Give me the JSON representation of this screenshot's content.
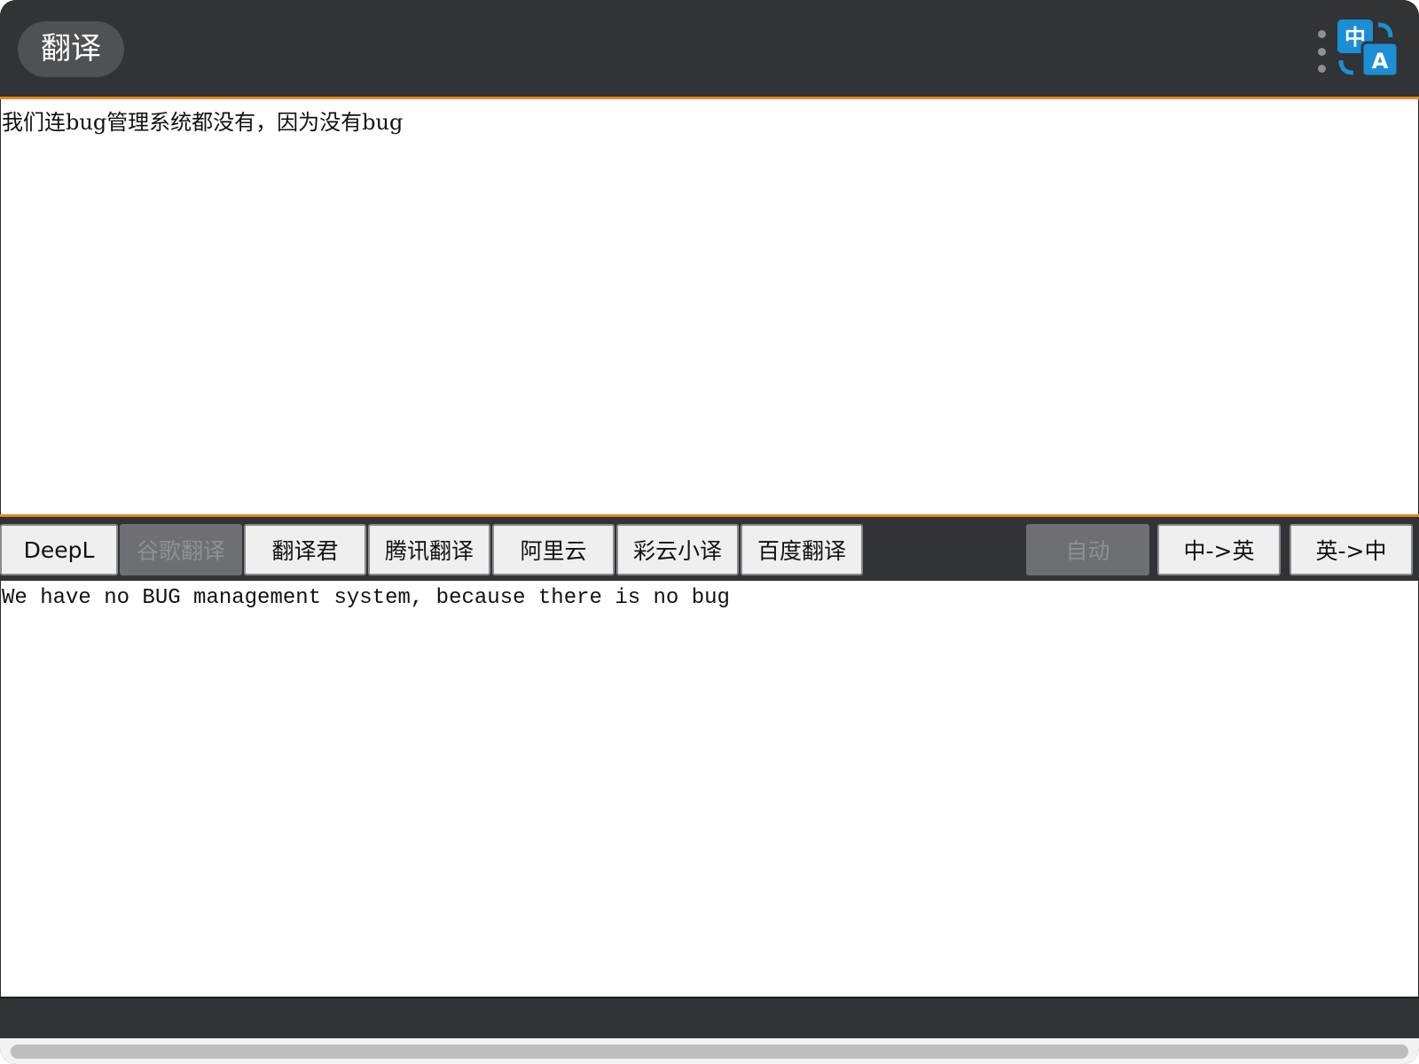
{
  "titlebar": {
    "title": "翻译",
    "menu_icon": "kebab-menu-icon",
    "logo_icon": "translate-zh-a-icon",
    "logo_glyph_zh": "中",
    "logo_glyph_en": "A"
  },
  "source": {
    "text": "我们连bug管理系统都没有，因为没有bug"
  },
  "engines": [
    {
      "label": "DeepL",
      "disabled": false
    },
    {
      "label": "谷歌翻译",
      "disabled": true
    },
    {
      "label": "翻译君",
      "disabled": false
    },
    {
      "label": "腾讯翻译",
      "disabled": false
    },
    {
      "label": "阿里云",
      "disabled": false
    },
    {
      "label": "彩云小译",
      "disabled": false
    },
    {
      "label": "百度翻译",
      "disabled": false
    }
  ],
  "directions": [
    {
      "label": "自动",
      "disabled": true
    },
    {
      "label": "中->英",
      "disabled": false
    },
    {
      "label": "英->中",
      "disabled": false
    }
  ],
  "result": {
    "text": "We have no BUG management system, because there is no bug"
  },
  "colors": {
    "bar_background": "#323336",
    "accent_orange": "#e68a1e",
    "logo_blue": "#1a8fd6"
  }
}
